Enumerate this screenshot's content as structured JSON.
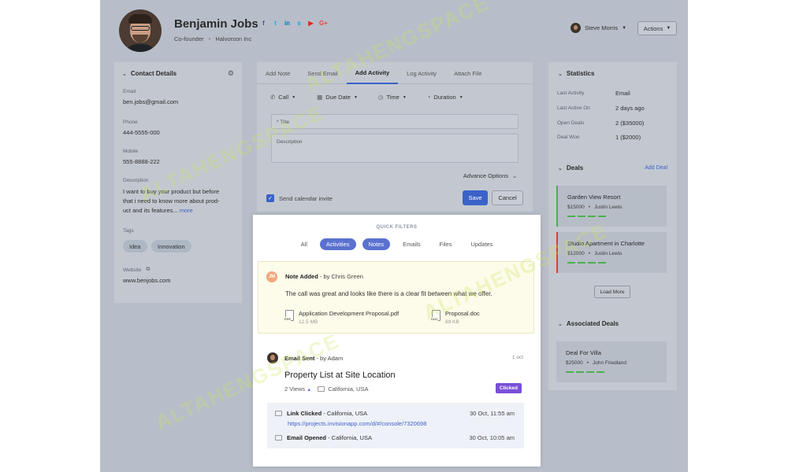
{
  "profile": {
    "name": "Benjamin Jobs",
    "role": "Co-founder",
    "company": "Halvorson Inc",
    "socials": [
      {
        "icon": "facebook-icon",
        "glyph": "f",
        "color": "#3b5998"
      },
      {
        "icon": "twitter-icon",
        "glyph": "t",
        "color": "#1da1f2"
      },
      {
        "icon": "linkedin-icon",
        "glyph": "in",
        "color": "#0077b5"
      },
      {
        "icon": "skype-icon",
        "glyph": "s",
        "color": "#00aff0"
      },
      {
        "icon": "youtube-icon",
        "glyph": "▶",
        "color": "#e62117"
      },
      {
        "icon": "google-plus-icon",
        "glyph": "G+",
        "color": "#dd4b39"
      }
    ]
  },
  "header": {
    "user_name": "Steve Morris",
    "actions_label": "Actions"
  },
  "contact": {
    "title": "Contact Details",
    "email_label": "Email",
    "email": "ben.jobs@gmail.com",
    "phone_label": "Phone",
    "phone": "444-5555-000",
    "mobile_label": "Mobile",
    "mobile": "555-8888-222",
    "description_label": "Description",
    "description_lines": [
      "I want to buy your product but before",
      "that i need to know more about prod-",
      "uct and its features..."
    ],
    "more_link": "more",
    "tags_label": "Tags",
    "tags": [
      "Idea",
      "Innovation"
    ],
    "website_label": "Website",
    "website": "www.benjobs.com"
  },
  "composer": {
    "tabs": [
      "Add Note",
      "Send Email",
      "Add Activity",
      "Log Activity",
      "Attach File"
    ],
    "active_tab": "Add Activity",
    "options": [
      {
        "icon": "phone-icon",
        "glyph": "✆",
        "label": "Call"
      },
      {
        "icon": "calendar-icon",
        "glyph": "▦",
        "label": "Due Date"
      },
      {
        "icon": "clock-icon",
        "glyph": "◷",
        "label": "Time"
      },
      {
        "icon": "timer-icon",
        "glyph": "◔",
        "label": "Duration"
      }
    ],
    "title_placeholder": "* Title",
    "description_placeholder": "Description",
    "advance_options": "Advance Options",
    "send_invite_label": "Send calendar invite",
    "save_label": "Save",
    "cancel_label": "Cancel"
  },
  "filters": {
    "title": "QUICK FILTERS",
    "items": [
      {
        "label": "All",
        "active": false
      },
      {
        "label": "Activities",
        "active": true
      },
      {
        "label": "Notes",
        "active": true
      },
      {
        "label": "Emails",
        "active": false
      },
      {
        "label": "Files",
        "active": false
      },
      {
        "label": "Updates",
        "active": false
      }
    ]
  },
  "note": {
    "initials": "JM",
    "type": "Note Added",
    "by": " - by Chris Green",
    "body": "The call was great and looks like there is a clear fit between what we offer.",
    "files": [
      {
        "name": "Application Development Proposal.pdf",
        "size": "12.5 MB",
        "ext": "PDF"
      },
      {
        "name": "Proposal.doc",
        "size": "89 KB",
        "ext": "DOC"
      }
    ]
  },
  "email": {
    "type": "Email Sent",
    "by": " - by Adam",
    "time": "1 oct",
    "title": "Property List at Site Location",
    "views": "2 Views",
    "location": "California, USA",
    "status": "Clicked",
    "events": [
      {
        "action": "Link Clicked",
        "location": " - California, USA",
        "time": "30 Oct, 11:55 am",
        "link": "https://projects.invisionapp.com/d/#/console/7320698"
      },
      {
        "action": "Email Opened",
        "location": " - California, USA",
        "time": "30 Oct, 10:05 am",
        "link": ""
      }
    ]
  },
  "stats": {
    "title": "Statistics",
    "rows": [
      {
        "label": "Last Activity",
        "value": "Email"
      },
      {
        "label": "Last Active On",
        "value": "2 days ago"
      },
      {
        "label": "Open Deals",
        "value": "2 ($35000)"
      },
      {
        "label": "Deal Won",
        "value": "1 ($2000)"
      }
    ]
  },
  "deals": {
    "title": "Deals",
    "add_label": "Add Deal",
    "items": [
      {
        "name": "Garden View Resort",
        "amount": "$15000",
        "owner": "Justin Lewis",
        "accent": "#4caf50"
      },
      {
        "name": "Studio Apartment in Charlotte",
        "amount": "$12000",
        "owner": "Justin Lewis",
        "accent": "#e53935"
      }
    ],
    "load_more": "Load More"
  },
  "associated": {
    "title": "Associated Deals",
    "items": [
      {
        "name": "Deal For Villa",
        "amount": "$25000",
        "owner": "John Friedland"
      }
    ]
  },
  "watermark": "ALTAHENGSPACE"
}
